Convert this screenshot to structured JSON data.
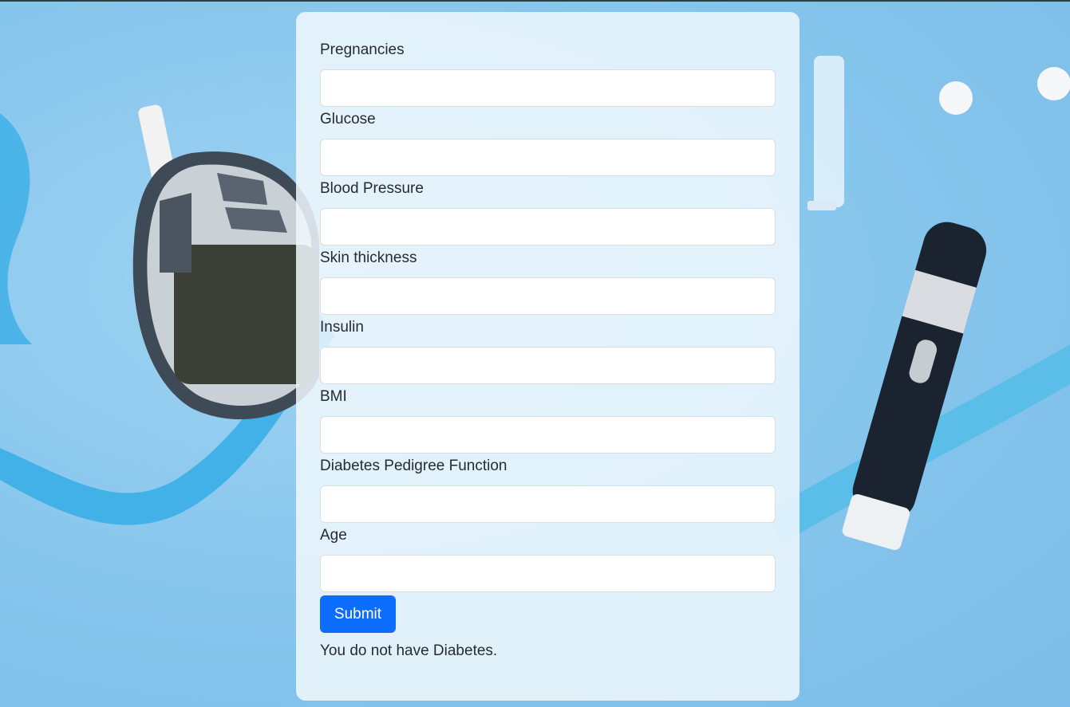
{
  "form": {
    "fields": [
      {
        "label": "Pregnancies",
        "value": ""
      },
      {
        "label": "Glucose",
        "value": ""
      },
      {
        "label": "Blood Pressure",
        "value": ""
      },
      {
        "label": "Skin thickness",
        "value": ""
      },
      {
        "label": "Insulin",
        "value": ""
      },
      {
        "label": "BMI",
        "value": ""
      },
      {
        "label": "Diabetes Pedigree Function",
        "value": ""
      },
      {
        "label": "Age",
        "value": ""
      }
    ],
    "submit_label": "Submit",
    "result_text": "You do not have Diabetes."
  },
  "colors": {
    "background": "#8ecbee",
    "card": "#f0f8fd",
    "button": "#0d6efd",
    "text": "#262b30"
  },
  "background_image": {
    "objects": [
      "glucose-meter",
      "blue-ribbon",
      "lancet-pen",
      "pills",
      "syringe",
      "test-strip"
    ]
  }
}
